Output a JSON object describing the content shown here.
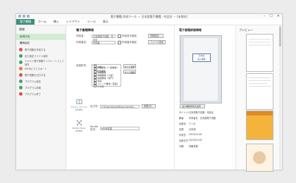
{
  "window": {
    "title": "電子書籍 作成ツール － 日本語電子書籍 · 作品名 － [未保存]",
    "controls": [
      "–",
      "☐",
      "✕"
    ]
  },
  "menu": [
    {
      "label": "電子書籍",
      "active": true
    },
    {
      "label": "ホーム",
      "active": false
    },
    {
      "label": "挿入",
      "active": false
    },
    {
      "label": "レイアウト",
      "active": false
    },
    {
      "label": "ツール",
      "active": false
    },
    {
      "label": "表示",
      "active": false
    }
  ],
  "sidebar": {
    "header": "情報",
    "create": "新規作成",
    "open_section": "読み込む",
    "items": [
      {
        "label": "電子書籍を作成する",
        "color": "#e05050"
      },
      {
        "label": "出力設定ファイル保存",
        "color": "#3fa46a"
      },
      {
        "label": "テキスト電子書籍テンプレートとして保存",
        "color": "#3fa46a"
      },
      {
        "label": "EPUBにエクスポート",
        "color": "#e08030"
      },
      {
        "label": "電子書籍を出力する",
        "color": "#e05050"
      },
      {
        "label": "プログラム設定",
        "color": "#3fa46a"
      },
      {
        "label": "プログラム情報",
        "color": "#3fa46a"
      },
      {
        "label": "プログラム終了",
        "color": "#e05050"
      }
    ]
  },
  "form": {
    "section_title": "電子書籍情報",
    "title_label": "作品名:",
    "title_value": "日本語電子書籍 · 作品名",
    "title_check": "作品名を固定",
    "edit_button": "詳細設定...",
    "author_label": "作成者名:",
    "author_value": "作成者",
    "author_check": "作成者を固定",
    "author_button": "ファイル設定",
    "category_label": "出版形式:",
    "categories": [
      "小説",
      "情報書籍（一般書籍）・総合書籍",
      "情報書籍",
      "情報書籍（小説）",
      "情報書籍（専門）",
      "漫画",
      "コミック書籍（漫画）",
      "その他"
    ],
    "add_button": "すべて選択",
    "remove_button": "すべて解除",
    "epub_icon_label": "テキスト/ファイル ePUB化",
    "epub_field_label": "出力先:",
    "epub_field_value": "C:¥Users¥user¥Documents¥...",
    "epub_button": "参照(B)...",
    "share_icon_label": "Kindle / Nook ePUB化",
    "share_field_label": "Kindle形式:",
    "share_field_value": "ePUB変換"
  },
  "detail": {
    "title": "電子書籍詳細情報",
    "cover_line1": "日本語",
    "cover_line2": "電子書籍",
    "cover_button": "電子書籍情報を設定...",
    "rows": [
      {
        "k": "タイトル:",
        "v": "日本語電子書籍 · 作品名"
      },
      {
        "k": "著者:",
        "v": "作成者名 · 日本語電子書籍"
      },
      {
        "k": "出版社:",
        "v": "テンポ"
      },
      {
        "k": "言語:",
        "v": "日本語"
      },
      {
        "k": "作成日:",
        "v": "2023/01/18"
      },
      {
        "k": "出版日付:",
        "v": "2023/01/18"
      },
      {
        "k": "分類:",
        "v": "情報書籍"
      }
    ]
  },
  "preview": {
    "title": "プレビュー"
  }
}
